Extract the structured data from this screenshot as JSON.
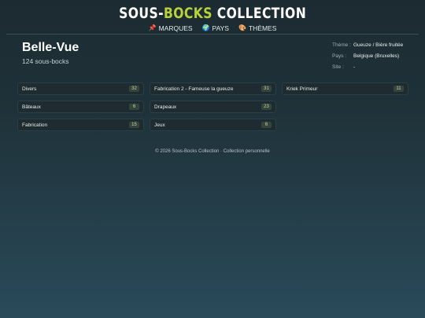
{
  "header": {
    "brand_part1": "SOUS-",
    "brand_accent": "BOCKS",
    "brand_part2": " COLLECTION",
    "nav": [
      {
        "icon": "📌",
        "label": "MARQUES"
      },
      {
        "icon": "🌍",
        "label": "PAYS"
      },
      {
        "icon": "🎨",
        "label": "THÈMES"
      }
    ]
  },
  "brand_page": {
    "title": "Belle-Vue",
    "subtitle": "124 sous-bocks"
  },
  "meta": [
    {
      "key": "Thème :",
      "value": "Gueuze / Bière fruitée"
    },
    {
      "key": "Pays :",
      "value": "Belgique (Bruxelles)"
    },
    {
      "key": "Site :",
      "value": "-"
    }
  ],
  "categories": [
    {
      "label": "Divers",
      "count": "32"
    },
    {
      "label": "Fabrication 2 - Fameuse la gueuze",
      "count": "31"
    },
    {
      "label": "Kriek Primeur",
      "count": "11"
    },
    {
      "label": "Bâteaux",
      "count": "6"
    },
    {
      "label": "Drapeaux",
      "count": "23"
    },
    {
      "label": "Fabrication",
      "count": "15"
    },
    {
      "label": "Jeux",
      "count": "6"
    }
  ],
  "footer": "© 2026 Sous-Bocks Collection · Collection personnelle",
  "colors": {
    "accent": "#b9d23a",
    "badge_bg": "#33453d",
    "card_bg": "#1e2c32"
  }
}
